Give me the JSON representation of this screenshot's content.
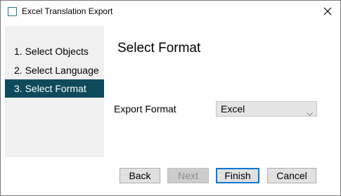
{
  "window": {
    "title": "Excel Translation Export",
    "icon": "app-window-icon",
    "close_icon": "close-icon"
  },
  "sidebar": {
    "steps": [
      {
        "label": "1. Select Objects",
        "active": false
      },
      {
        "label": "2. Select Language",
        "active": false
      },
      {
        "label": "3. Select Format",
        "active": true
      }
    ]
  },
  "main": {
    "heading": "Select Format",
    "export_format": {
      "label": "Export Format",
      "value": "Excel"
    }
  },
  "buttons": {
    "back": "Back",
    "next": "Next",
    "finish": "Finish",
    "cancel": "Cancel"
  },
  "colors": {
    "active_step_bg": "#0e4b5a",
    "sidebar_bg": "#f0f0f0",
    "focus_border": "#0078d7"
  }
}
